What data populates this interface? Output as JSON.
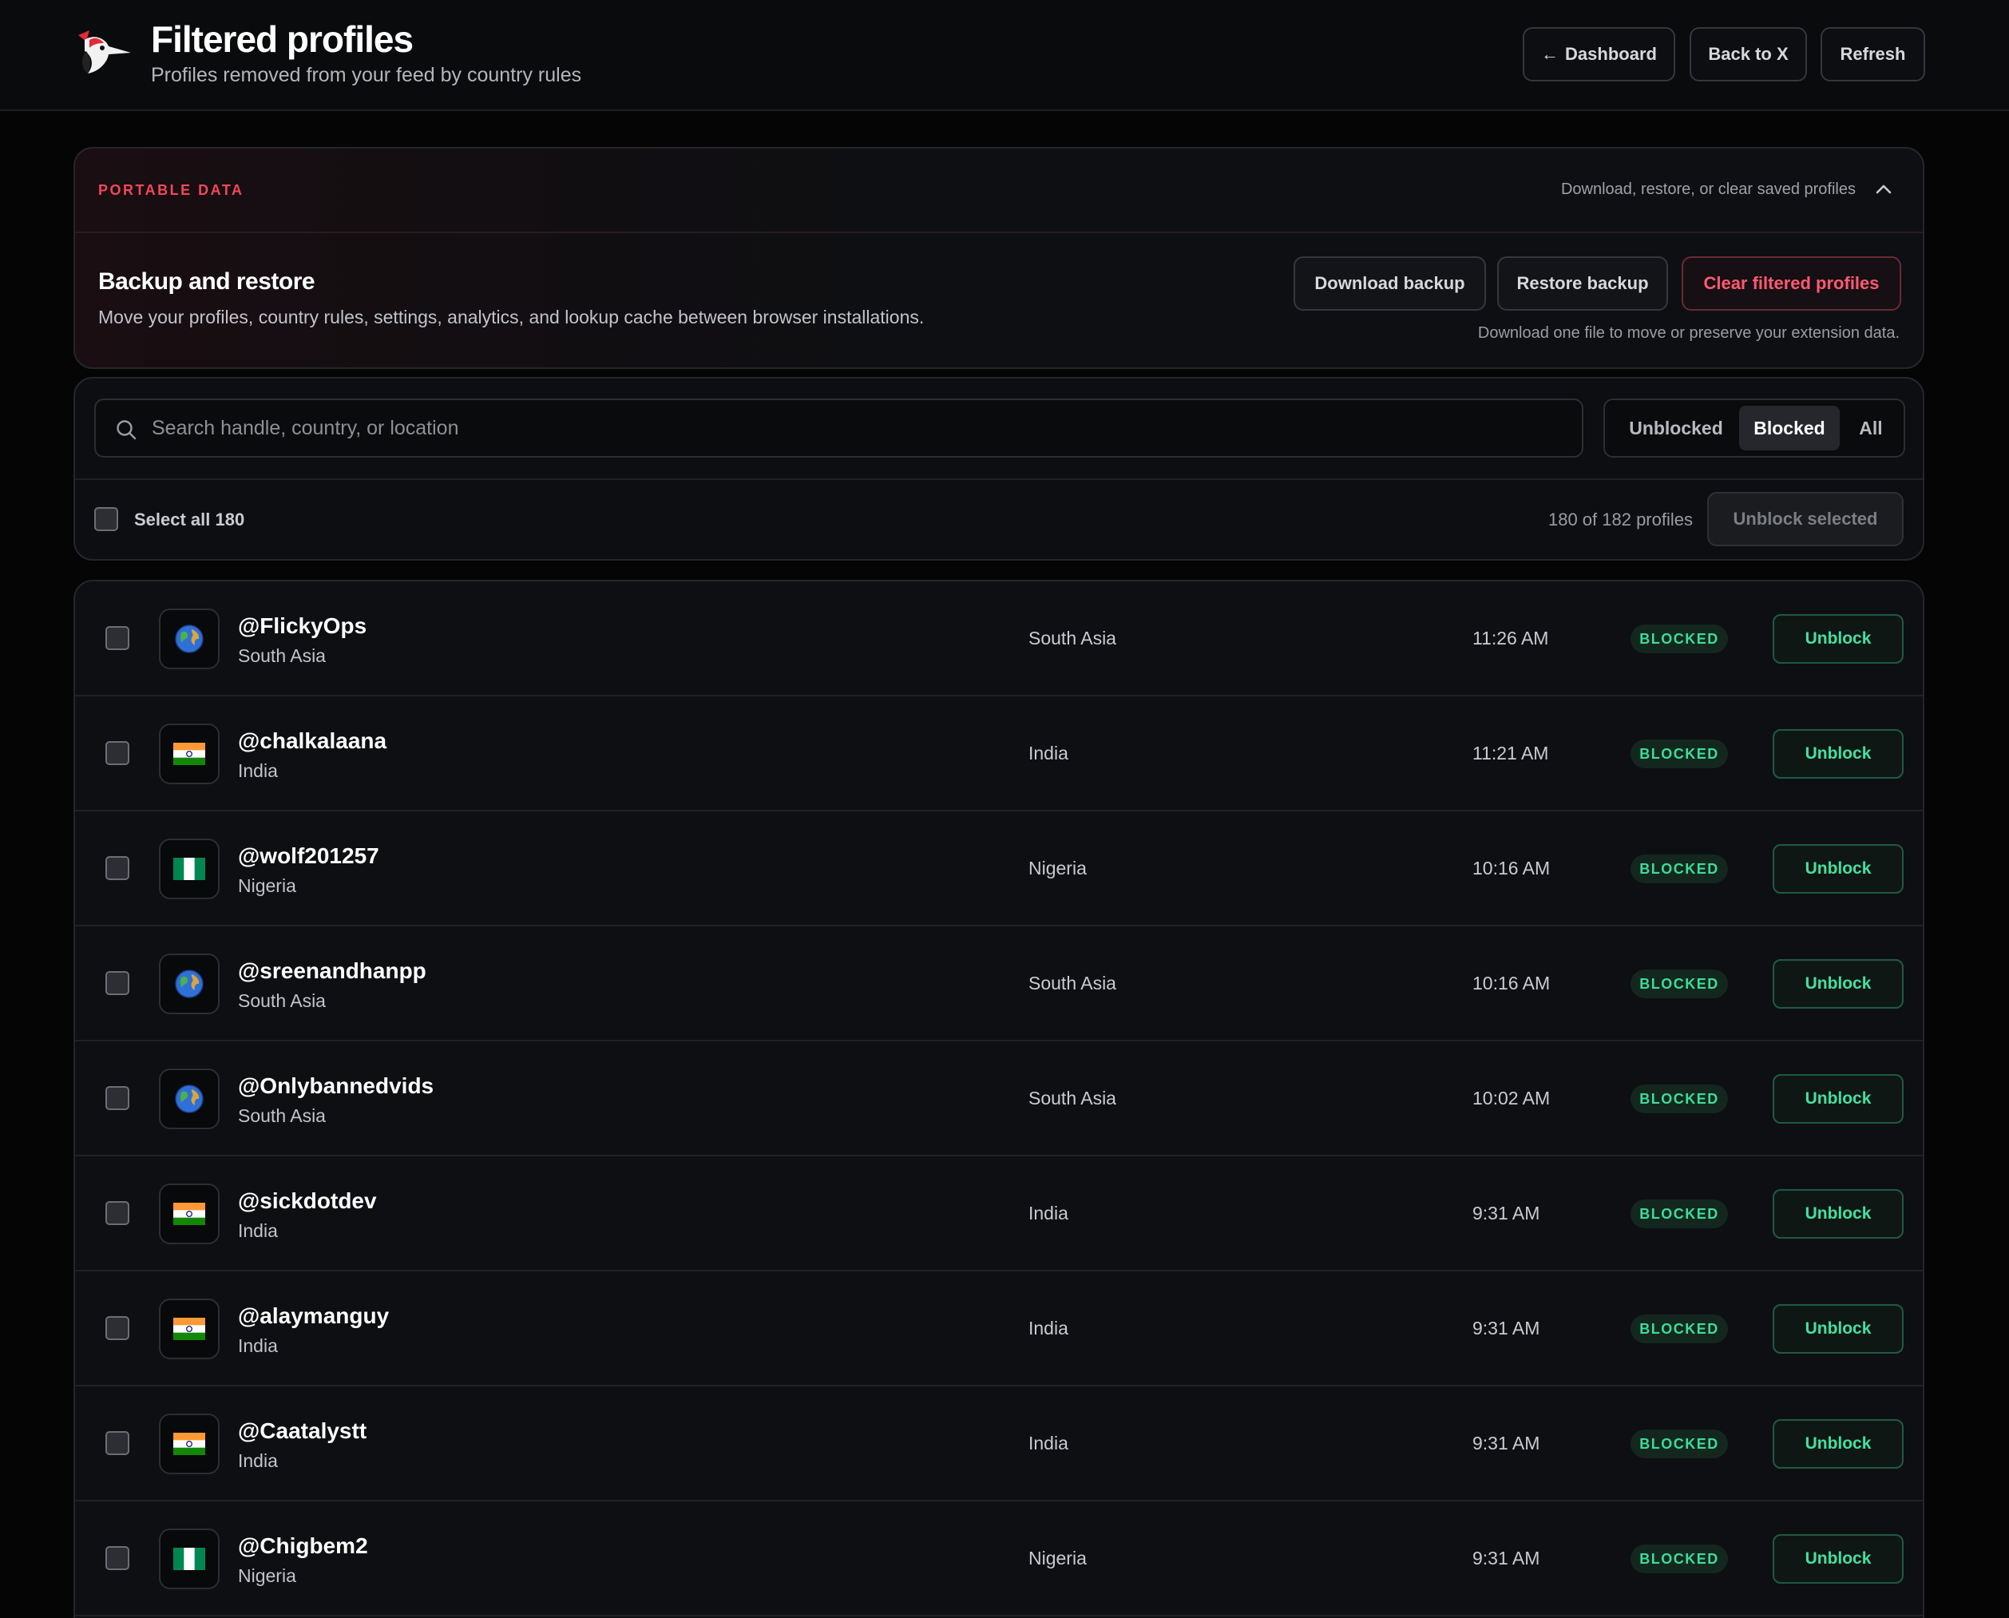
{
  "header": {
    "title": "Filtered profiles",
    "subtitle": "Profiles removed from your feed by country rules",
    "dashboard_label": "Dashboard",
    "back_label": "Back to X",
    "refresh_label": "Refresh"
  },
  "portable": {
    "eyebrow": "PORTABLE DATA",
    "collapse_hint": "Download, restore, or clear saved profiles",
    "title": "Backup and restore",
    "description": "Move your profiles, country rules, settings, analytics, and lookup cache between browser installations.",
    "download_label": "Download backup",
    "restore_label": "Restore backup",
    "clear_label": "Clear filtered profiles",
    "note": "Download one file to move or preserve your extension data."
  },
  "filters": {
    "search_placeholder": "Search handle, country, or location",
    "search_value": "",
    "segments": [
      "Unblocked",
      "Blocked",
      "All"
    ],
    "active_segment": "Blocked",
    "select_all_label": "Select all 180",
    "count_text": "180 of 182 profiles",
    "unblock_selected_label": "Unblock selected"
  },
  "profiles": [
    {
      "handle": "@FlickyOps",
      "location": "South Asia",
      "flag": "globe-icon",
      "time": "11:26 AM",
      "status": "BLOCKED",
      "action": "Unblock"
    },
    {
      "handle": "@chalkalaana",
      "location": "India",
      "flag": "india-flag-icon",
      "time": "11:21 AM",
      "status": "BLOCKED",
      "action": "Unblock"
    },
    {
      "handle": "@wolf201257",
      "location": "Nigeria",
      "flag": "nigeria-flag-icon",
      "time": "10:16 AM",
      "status": "BLOCKED",
      "action": "Unblock"
    },
    {
      "handle": "@sreenandhanpp",
      "location": "South Asia",
      "flag": "globe-icon",
      "time": "10:16 AM",
      "status": "BLOCKED",
      "action": "Unblock"
    },
    {
      "handle": "@Onlybannedvids",
      "location": "South Asia",
      "flag": "globe-icon",
      "time": "10:02 AM",
      "status": "BLOCKED",
      "action": "Unblock"
    },
    {
      "handle": "@sickdotdev",
      "location": "India",
      "flag": "india-flag-icon",
      "time": "9:31 AM",
      "status": "BLOCKED",
      "action": "Unblock"
    },
    {
      "handle": "@alaymanguy",
      "location": "India",
      "flag": "india-flag-icon",
      "time": "9:31 AM",
      "status": "BLOCKED",
      "action": "Unblock"
    },
    {
      "handle": "@Caatalystt",
      "location": "India",
      "flag": "india-flag-icon",
      "time": "9:31 AM",
      "status": "BLOCKED",
      "action": "Unblock"
    },
    {
      "handle": "@Chigbem2",
      "location": "Nigeria",
      "flag": "nigeria-flag-icon",
      "time": "9:31 AM",
      "status": "BLOCKED",
      "action": "Unblock"
    }
  ],
  "colors": {
    "accent_red": "#f2475a",
    "status_green": "#3ddc97",
    "background": "#050506"
  }
}
